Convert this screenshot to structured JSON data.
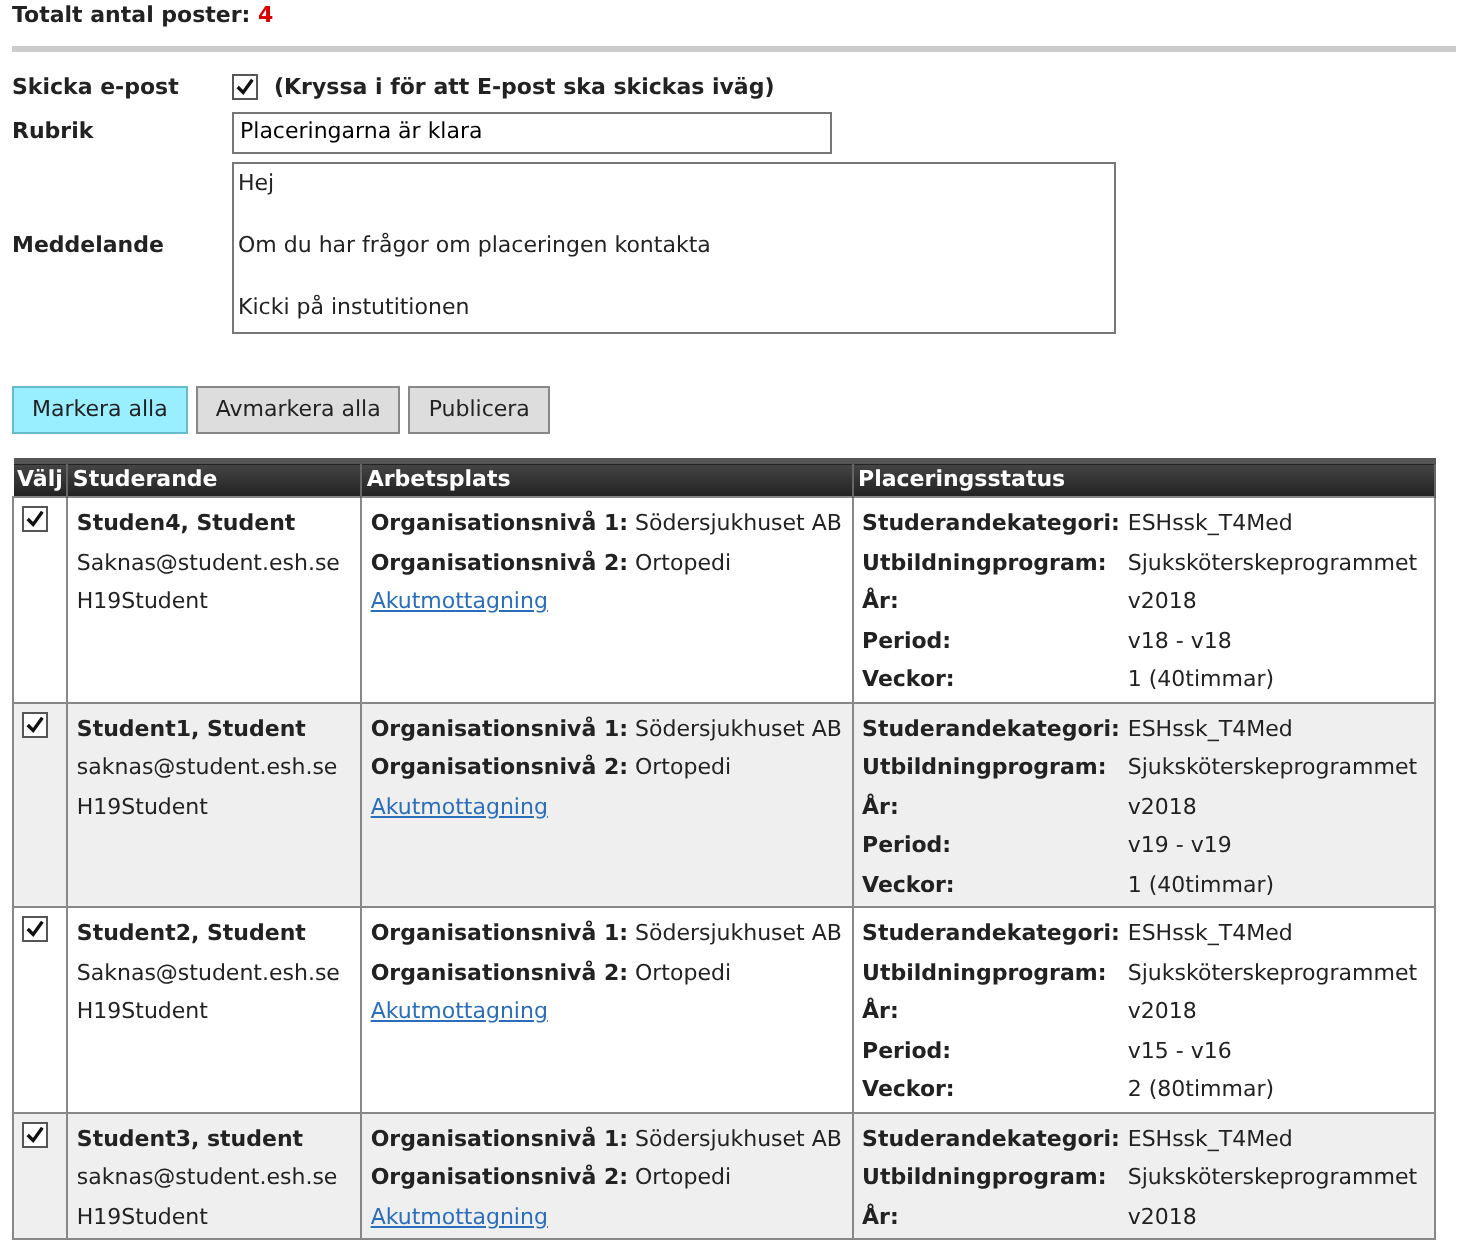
{
  "total": {
    "label": "Totalt antal poster:",
    "count": "4"
  },
  "form": {
    "send_email": {
      "label": "Skicka e-post",
      "checked": true,
      "hint": "(Kryssa i för att E-post ska skickas iväg)"
    },
    "subject": {
      "label": "Rubrik",
      "value": "Placeringarna är klara"
    },
    "message": {
      "label": "Meddelande",
      "lines": [
        "Hej",
        "Om du har frågor om placeringen kontakta",
        "Kicki på instutitionen"
      ]
    }
  },
  "buttons": [
    {
      "label": "Markera alla",
      "selected": true
    },
    {
      "label": "Avmarkera alla",
      "selected": false
    },
    {
      "label": "Publicera",
      "selected": false
    }
  ],
  "table": {
    "columns": [
      "Välj",
      "Studerande",
      "Arbetsplats",
      "Placeringsstatus"
    ],
    "rows": [
      {
        "checked": true,
        "name": "Studen4, Student",
        "email": "Saknas@student.esh.se",
        "group": "H19Student",
        "workplace": [
          {
            "label": "Organisationsnivå 1:",
            "value": "Södersjukhuset AB"
          },
          {
            "label": "Organisationsnivå 2:",
            "value": "Ortopedi"
          }
        ],
        "unit_link": "Akutmottagning",
        "status": [
          {
            "label": "Studerandekategori:",
            "value": "ESHssk_T4Med"
          },
          {
            "label": "Utbildningprogram:",
            "value": "Sjuksköterskeprogrammet"
          },
          {
            "label": "År:",
            "value": "v2018"
          },
          {
            "label": "Period:",
            "value": "v18 - v18"
          },
          {
            "label": "Veckor:",
            "value": "1 (40timmar)"
          }
        ]
      },
      {
        "checked": true,
        "name": "Student1, Student",
        "email": "saknas@student.esh.se",
        "group": "H19Student",
        "workplace": [
          {
            "label": "Organisationsnivå 1:",
            "value": "Södersjukhuset AB"
          },
          {
            "label": "Organisationsnivå 2:",
            "value": "Ortopedi"
          }
        ],
        "unit_link": "Akutmottagning",
        "status": [
          {
            "label": "Studerandekategori:",
            "value": "ESHssk_T4Med"
          },
          {
            "label": "Utbildningprogram:",
            "value": "Sjuksköterskeprogrammet"
          },
          {
            "label": "År:",
            "value": "v2018"
          },
          {
            "label": "Period:",
            "value": "v19 - v19"
          },
          {
            "label": "Veckor:",
            "value": "1 (40timmar)"
          }
        ]
      },
      {
        "checked": true,
        "name": "Student2, Student",
        "email": "Saknas@student.esh.se",
        "group": "H19Student",
        "workplace": [
          {
            "label": "Organisationsnivå 1:",
            "value": "Södersjukhuset AB"
          },
          {
            "label": "Organisationsnivå 2:",
            "value": "Ortopedi"
          }
        ],
        "unit_link": "Akutmottagning",
        "status": [
          {
            "label": "Studerandekategori:",
            "value": "ESHssk_T4Med"
          },
          {
            "label": "Utbildningprogram:",
            "value": "Sjuksköterskeprogrammet"
          },
          {
            "label": "År:",
            "value": "v2018"
          },
          {
            "label": "Period:",
            "value": "v15 - v16"
          },
          {
            "label": "Veckor:",
            "value": "2 (80timmar)"
          }
        ]
      },
      {
        "checked": true,
        "name": "Student3, student",
        "email": "saknas@student.esh.se",
        "group": "H19Student",
        "workplace": [
          {
            "label": "Organisationsnivå 1:",
            "value": "Södersjukhuset AB"
          },
          {
            "label": "Organisationsnivå 2:",
            "value": "Ortopedi"
          }
        ],
        "unit_link": "Akutmottagning",
        "status": [
          {
            "label": "Studerandekategori:",
            "value": "ESHssk_T4Med"
          },
          {
            "label": "Utbildningprogram:",
            "value": "Sjuksköterskeprogrammet"
          },
          {
            "label": "År:",
            "value": "v2018"
          }
        ]
      }
    ]
  }
}
